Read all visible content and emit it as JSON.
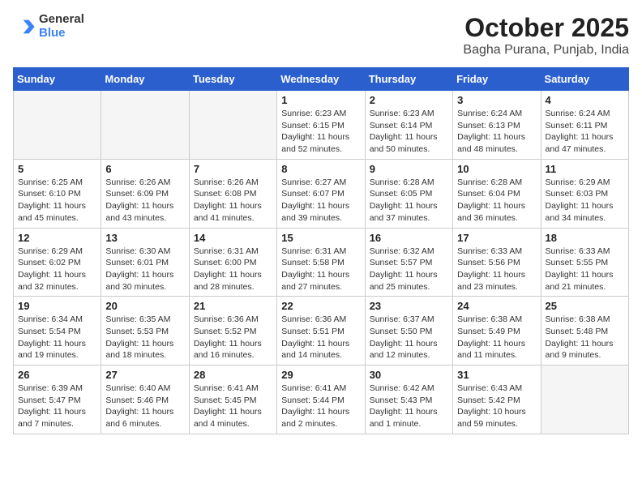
{
  "header": {
    "logo": {
      "line1": "General",
      "line2": "Blue"
    },
    "title": "October 2025",
    "subtitle": "Bagha Purana, Punjab, India"
  },
  "weekdays": [
    "Sunday",
    "Monday",
    "Tuesday",
    "Wednesday",
    "Thursday",
    "Friday",
    "Saturday"
  ],
  "weeks": [
    [
      {
        "day": "",
        "info": ""
      },
      {
        "day": "",
        "info": ""
      },
      {
        "day": "",
        "info": ""
      },
      {
        "day": "1",
        "info": "Sunrise: 6:23 AM\nSunset: 6:15 PM\nDaylight: 11 hours\nand 52 minutes."
      },
      {
        "day": "2",
        "info": "Sunrise: 6:23 AM\nSunset: 6:14 PM\nDaylight: 11 hours\nand 50 minutes."
      },
      {
        "day": "3",
        "info": "Sunrise: 6:24 AM\nSunset: 6:13 PM\nDaylight: 11 hours\nand 48 minutes."
      },
      {
        "day": "4",
        "info": "Sunrise: 6:24 AM\nSunset: 6:11 PM\nDaylight: 11 hours\nand 47 minutes."
      }
    ],
    [
      {
        "day": "5",
        "info": "Sunrise: 6:25 AM\nSunset: 6:10 PM\nDaylight: 11 hours\nand 45 minutes."
      },
      {
        "day": "6",
        "info": "Sunrise: 6:26 AM\nSunset: 6:09 PM\nDaylight: 11 hours\nand 43 minutes."
      },
      {
        "day": "7",
        "info": "Sunrise: 6:26 AM\nSunset: 6:08 PM\nDaylight: 11 hours\nand 41 minutes."
      },
      {
        "day": "8",
        "info": "Sunrise: 6:27 AM\nSunset: 6:07 PM\nDaylight: 11 hours\nand 39 minutes."
      },
      {
        "day": "9",
        "info": "Sunrise: 6:28 AM\nSunset: 6:05 PM\nDaylight: 11 hours\nand 37 minutes."
      },
      {
        "day": "10",
        "info": "Sunrise: 6:28 AM\nSunset: 6:04 PM\nDaylight: 11 hours\nand 36 minutes."
      },
      {
        "day": "11",
        "info": "Sunrise: 6:29 AM\nSunset: 6:03 PM\nDaylight: 11 hours\nand 34 minutes."
      }
    ],
    [
      {
        "day": "12",
        "info": "Sunrise: 6:29 AM\nSunset: 6:02 PM\nDaylight: 11 hours\nand 32 minutes."
      },
      {
        "day": "13",
        "info": "Sunrise: 6:30 AM\nSunset: 6:01 PM\nDaylight: 11 hours\nand 30 minutes."
      },
      {
        "day": "14",
        "info": "Sunrise: 6:31 AM\nSunset: 6:00 PM\nDaylight: 11 hours\nand 28 minutes."
      },
      {
        "day": "15",
        "info": "Sunrise: 6:31 AM\nSunset: 5:58 PM\nDaylight: 11 hours\nand 27 minutes."
      },
      {
        "day": "16",
        "info": "Sunrise: 6:32 AM\nSunset: 5:57 PM\nDaylight: 11 hours\nand 25 minutes."
      },
      {
        "day": "17",
        "info": "Sunrise: 6:33 AM\nSunset: 5:56 PM\nDaylight: 11 hours\nand 23 minutes."
      },
      {
        "day": "18",
        "info": "Sunrise: 6:33 AM\nSunset: 5:55 PM\nDaylight: 11 hours\nand 21 minutes."
      }
    ],
    [
      {
        "day": "19",
        "info": "Sunrise: 6:34 AM\nSunset: 5:54 PM\nDaylight: 11 hours\nand 19 minutes."
      },
      {
        "day": "20",
        "info": "Sunrise: 6:35 AM\nSunset: 5:53 PM\nDaylight: 11 hours\nand 18 minutes."
      },
      {
        "day": "21",
        "info": "Sunrise: 6:36 AM\nSunset: 5:52 PM\nDaylight: 11 hours\nand 16 minutes."
      },
      {
        "day": "22",
        "info": "Sunrise: 6:36 AM\nSunset: 5:51 PM\nDaylight: 11 hours\nand 14 minutes."
      },
      {
        "day": "23",
        "info": "Sunrise: 6:37 AM\nSunset: 5:50 PM\nDaylight: 11 hours\nand 12 minutes."
      },
      {
        "day": "24",
        "info": "Sunrise: 6:38 AM\nSunset: 5:49 PM\nDaylight: 11 hours\nand 11 minutes."
      },
      {
        "day": "25",
        "info": "Sunrise: 6:38 AM\nSunset: 5:48 PM\nDaylight: 11 hours\nand 9 minutes."
      }
    ],
    [
      {
        "day": "26",
        "info": "Sunrise: 6:39 AM\nSunset: 5:47 PM\nDaylight: 11 hours\nand 7 minutes."
      },
      {
        "day": "27",
        "info": "Sunrise: 6:40 AM\nSunset: 5:46 PM\nDaylight: 11 hours\nand 6 minutes."
      },
      {
        "day": "28",
        "info": "Sunrise: 6:41 AM\nSunset: 5:45 PM\nDaylight: 11 hours\nand 4 minutes."
      },
      {
        "day": "29",
        "info": "Sunrise: 6:41 AM\nSunset: 5:44 PM\nDaylight: 11 hours\nand 2 minutes."
      },
      {
        "day": "30",
        "info": "Sunrise: 6:42 AM\nSunset: 5:43 PM\nDaylight: 11 hours\nand 1 minute."
      },
      {
        "day": "31",
        "info": "Sunrise: 6:43 AM\nSunset: 5:42 PM\nDaylight: 10 hours\nand 59 minutes."
      },
      {
        "day": "",
        "info": ""
      }
    ]
  ]
}
